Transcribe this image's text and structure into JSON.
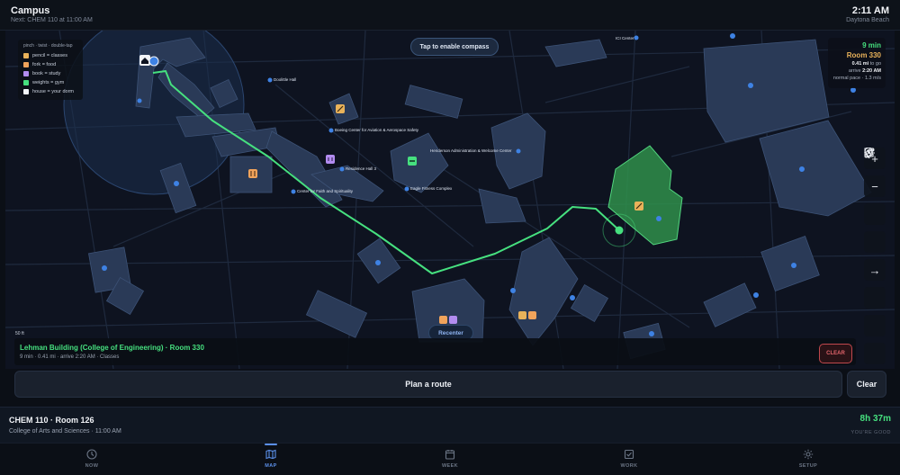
{
  "header": {
    "title": "Campus",
    "next": "Next: CHEM 110 at 11:00 AM",
    "time": "2:11 AM",
    "city": "Daytona Beach"
  },
  "legend": {
    "hint": "pinch · twist · double-tap",
    "items": [
      {
        "label": "pencil = classes",
        "color": "#e9b25a"
      },
      {
        "label": "fork = food",
        "color": "#f0a35b"
      },
      {
        "label": "book = study",
        "color": "#b28cf0"
      },
      {
        "label": "weights = gym",
        "color": "#46e07f"
      },
      {
        "label": "house = your dorm",
        "color": "#f2f4f8"
      }
    ]
  },
  "compass": {
    "label": "Tap to enable compass"
  },
  "eta": {
    "minutes": "9 min",
    "room": "Room 330",
    "distance_value": "0.41 mi",
    "distance_suffix": "to go",
    "arrive_prefix": "arrive",
    "arrive_value": "2:20 AM",
    "pace": "normal pace · 1.3 m/s"
  },
  "map": {
    "labels": [
      {
        "text": "ICI Center"
      },
      {
        "text": "Doolittle Hall"
      },
      {
        "text": "Boeing Center for Aviation & Aerospace Safety"
      },
      {
        "text": "Henderson Administration & Welcome Center"
      },
      {
        "text": "Residence Hall 3"
      },
      {
        "text": "Center for Faith and Spirituality"
      },
      {
        "text": "Eagle Fitness Complex"
      }
    ],
    "scale": "50 ft",
    "recenter": "Recenter"
  },
  "destination": {
    "title": "Lehman Building (College of Engineering) · Room 330",
    "subtitle": "9 min · 0.41 mi · arrive 2:20 AM · Classes",
    "clear": "CLEAR"
  },
  "controls": {
    "zoom_in": "+",
    "zoom_out": "−",
    "arrow": "→"
  },
  "route": {
    "plan": "Plan a route",
    "clear": "Clear"
  },
  "next_class": {
    "title": "CHEM 110 · Room 126",
    "subtitle": "College of Arts and Sciences · 11:00 AM",
    "countdown": "8h 37m",
    "status": "YOU'RE GOOD"
  },
  "nav": {
    "items": [
      {
        "label": "NOW"
      },
      {
        "label": "MAP"
      },
      {
        "label": "WEEK"
      },
      {
        "label": "WORK"
      },
      {
        "label": "SETUP"
      }
    ],
    "active": "MAP"
  },
  "colors": {
    "accent_green": "#46e07f",
    "accent_blue": "#5b8fe8",
    "danger": "#e3646b",
    "room_amber": "#e9b25a"
  }
}
